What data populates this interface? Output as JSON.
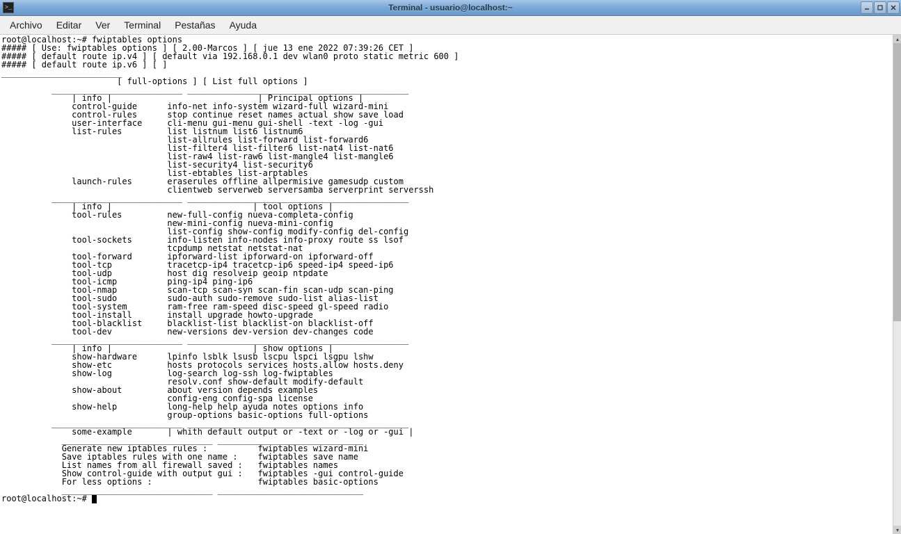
{
  "window": {
    "title": "Terminal - usuario@localhost:~",
    "icon_glyph": ">_"
  },
  "menu": {
    "items": [
      "Archivo",
      "Editar",
      "Ver",
      "Terminal",
      "Pestañas",
      "Ayuda"
    ]
  },
  "terminal": {
    "prompt1": "root@localhost:~# ",
    "command1": "fwiptables options",
    "header1": "##### [ Use: fwiptables options ] [ 2.00-Marcos ] [ jue 13 ene 2022 07:39:26 CET ]",
    "header2": "##### [ default route ip.v4 ] [ default via 192.168.0.1 dev wlan0 proto static metric 600 ]",
    "header3": "##### [ default route ip.v6 ] [ ]",
    "dash_top": "________________________",
    "full_opts_line": "                       [ full-options ] [ List full options ]",
    "sep_line": "          __________________________ ____________________________________________",
    "section1_header": "              | info |                             | Principal options |",
    "section1_rows": [
      "              control-guide      info-net info-system wizard-full wizard-mini",
      "              control-rules      stop continue reset names actual show save load",
      "              user-interface     cli-menu gui-menu gui-shell -text -log -gui",
      "              list-rules         list listnum list6 listnum6",
      "                                 list-allrules list-forward list-forward6",
      "                                 list-filter4 list-filter6 list-nat4 list-nat6",
      "                                 list-raw4 list-raw6 list-mangle4 list-mangle6",
      "                                 list-security4 list-security6",
      "                                 list-ebtables list-arptables",
      "              launch-rules       eraserules offline allpermisive gamesudp custom",
      "                                 clientweb serverweb serversamba serverprint serverssh"
    ],
    "section2_header": "              | info |                            | tool options |",
    "section2_rows": [
      "              tool-rules         new-full-config nueva-completa-config",
      "                                 new-mini-config nueva-mini-config",
      "                                 list-config show-config modify-config del-config",
      "              tool-sockets       info-listen info-nodes info-proxy route ss lsof",
      "                                 tcpdump netstat netstat-nat",
      "              tool-forward       ipforward-list ipforward-on ipforward-off",
      "              tool-tcp           tracetcp-ip4 tracetcp-ip6 speed-ip4 speed-ip6",
      "              tool-udp           host dig resolveip geoip ntpdate",
      "              tool-icmp          ping-ip4 ping-ip6",
      "              tool-nmap          scan-tcp scan-syn scan-fin scan-udp scan-ping",
      "              tool-sudo          sudo-auth sudo-remove sudo-list alias-list",
      "              tool-system        ram-free ram-speed disc-speed gl-speed radio",
      "              tool-install       install upgrade howto-upgrade",
      "              tool-blacklist     blacklist-list blacklist-on blacklist-off",
      "              tool-dev           new-versions dev-version dev-changes code"
    ],
    "section3_header": "              | info |                            | show options |",
    "section3_rows": [
      "              show-hardware      lpinfo lsblk lsusb lscpu lspci lsgpu lshw",
      "              show-etc           hosts protocols services hosts.allow hosts.deny",
      "              show-log           log-search log-ssh log-fwiptables",
      "                                 resolv.conf show-default modify-default",
      "              show-about         about version depends examples",
      "                                 config-eng config-spa license",
      "              show-help          long-help help ayuda notes options info",
      "                                 group-options basic-options full-options"
    ],
    "section4_header": "              some-example       | whith default output or -text or -log or -gui |",
    "sep_line2": "            ______________________________ _____________________________",
    "examples": [
      "            Generate new iptables rules :          fwiptables wizard-mini",
      "            Save iptables rules with one name :    fwiptables save name",
      "            List names from all firewall saved :   fwiptables names",
      "            Show control-guide with output gui :   fwiptables -gui control-guide",
      "            For less options :                     fwiptables basic-options"
    ],
    "prompt2": "root@localhost:~# "
  }
}
